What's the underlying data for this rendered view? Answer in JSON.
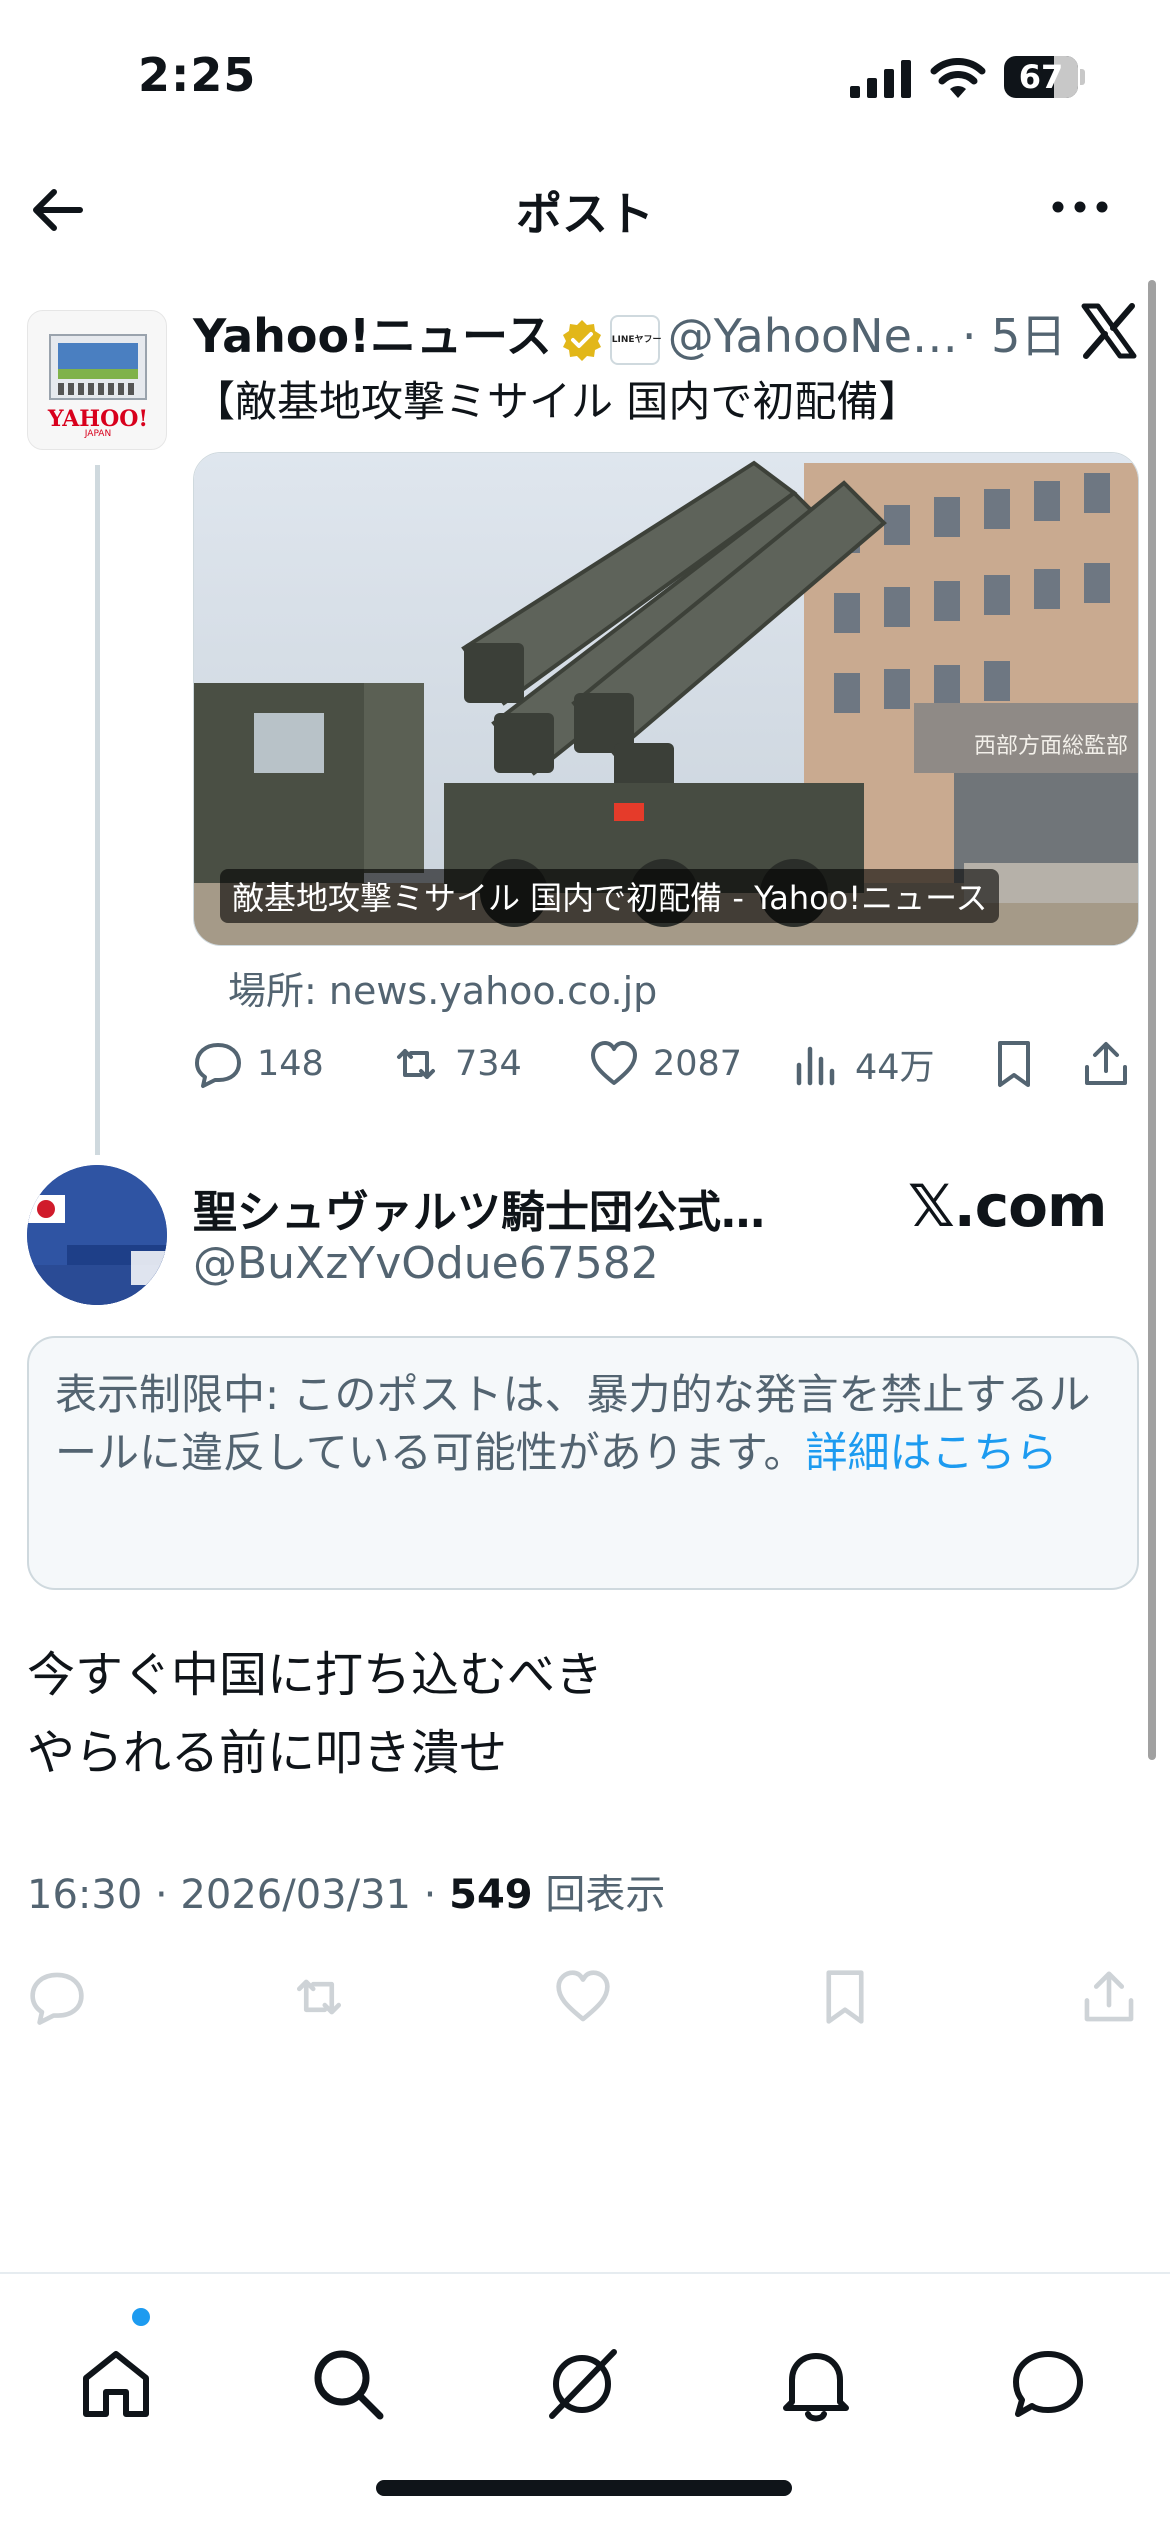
{
  "status_bar": {
    "time": "2:25",
    "battery": "67",
    "battery_level": 0.67
  },
  "header": {
    "title": "ポスト"
  },
  "parent_post": {
    "name": "Yahoo!ニュース",
    "badge_text": "LINEヤフー",
    "handle": "@YahooNe…",
    "time": "· 5日",
    "text": "【敵基地攻撃ミサイル 国内で初配備】",
    "avatar_text": "YAHOO!",
    "avatar_sub": "JAPAN",
    "card": {
      "caption": "敵基地攻撃ミサイル 国内で初配備 - Yahoo!ニュース",
      "sign_text": "西部方面総監部",
      "source": "場所: news.yahoo.co.jp"
    },
    "stats": {
      "replies": "148",
      "reposts": "734",
      "likes": "2087",
      "views": "44万"
    }
  },
  "main_post": {
    "name": "聖シュヴァルツ騎士団公式…",
    "handle": "@BuXzYvOdue67582",
    "watermark": "𝕏.com",
    "notice_text": "表示制限中: このポストは、暴力的な発言を禁止するルールに違反している可能性があります。",
    "notice_link": "詳細はこちら",
    "text_line1": "今すぐ中国に打ち込むべき",
    "text_line2": "やられる前に叩き潰せ",
    "meta_prefix": "16:30 · 2026/03/31 · ",
    "views_count": "549",
    "views_label": " 回表示"
  },
  "icons": {
    "back": "arrow-left-icon",
    "more": "more-icon",
    "x_logo": "x-logo-icon",
    "reply": "reply-icon",
    "repost": "repost-icon",
    "like": "heart-icon",
    "views": "views-icon",
    "bookmark": "bookmark-icon",
    "share": "share-icon",
    "home": "home-icon",
    "search": "search-icon",
    "grok": "grok-icon",
    "notifications": "bell-icon",
    "messages": "message-icon"
  },
  "colors": {
    "accent": "#1d9bf0",
    "text": "#0f1419",
    "muted": "#536471",
    "verified": "#e2b719"
  }
}
